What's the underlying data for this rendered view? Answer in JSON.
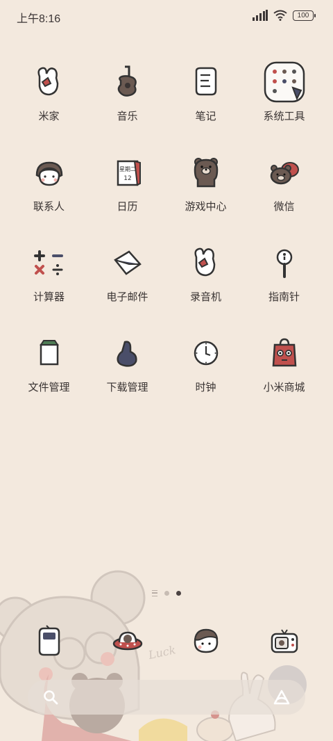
{
  "status_bar": {
    "time": "上午8:16",
    "battery": "100"
  },
  "apps": [
    {
      "label": "米家",
      "icon": "mitten-icon"
    },
    {
      "label": "音乐",
      "icon": "guitar-icon"
    },
    {
      "label": "笔记",
      "icon": "notepad-icon"
    },
    {
      "label": "系统工具",
      "icon": "folder-icon"
    },
    {
      "label": "联系人",
      "icon": "girl-face-icon"
    },
    {
      "label": "日历",
      "icon": "calendar-icon",
      "calendar_day": "星期二",
      "calendar_date": "12"
    },
    {
      "label": "游戏中心",
      "icon": "bear-icon"
    },
    {
      "label": "微信",
      "icon": "chat-bears-icon"
    },
    {
      "label": "计算器",
      "icon": "calculator-icon"
    },
    {
      "label": "电子邮件",
      "icon": "envelope-icon"
    },
    {
      "label": "录音机",
      "icon": "mitten-icon"
    },
    {
      "label": "指南针",
      "icon": "magnifier-icon"
    },
    {
      "label": "文件管理",
      "icon": "file-bag-icon"
    },
    {
      "label": "下载管理",
      "icon": "blob-icon"
    },
    {
      "label": "时钟",
      "icon": "clock-icon"
    },
    {
      "label": "小米商城",
      "icon": "shopping-bag-icon"
    }
  ],
  "dock": [
    {
      "name": "phone",
      "icon": "phone-icon"
    },
    {
      "name": "messages",
      "icon": "ufo-bear-icon"
    },
    {
      "name": "browser",
      "icon": "boy-face-icon"
    },
    {
      "name": "camera",
      "icon": "camera-radio-icon"
    }
  ],
  "colors": {
    "background": "#f3e9de",
    "text": "#3a3433",
    "accent_red": "#c0504d",
    "brown": "#6b5a52"
  }
}
